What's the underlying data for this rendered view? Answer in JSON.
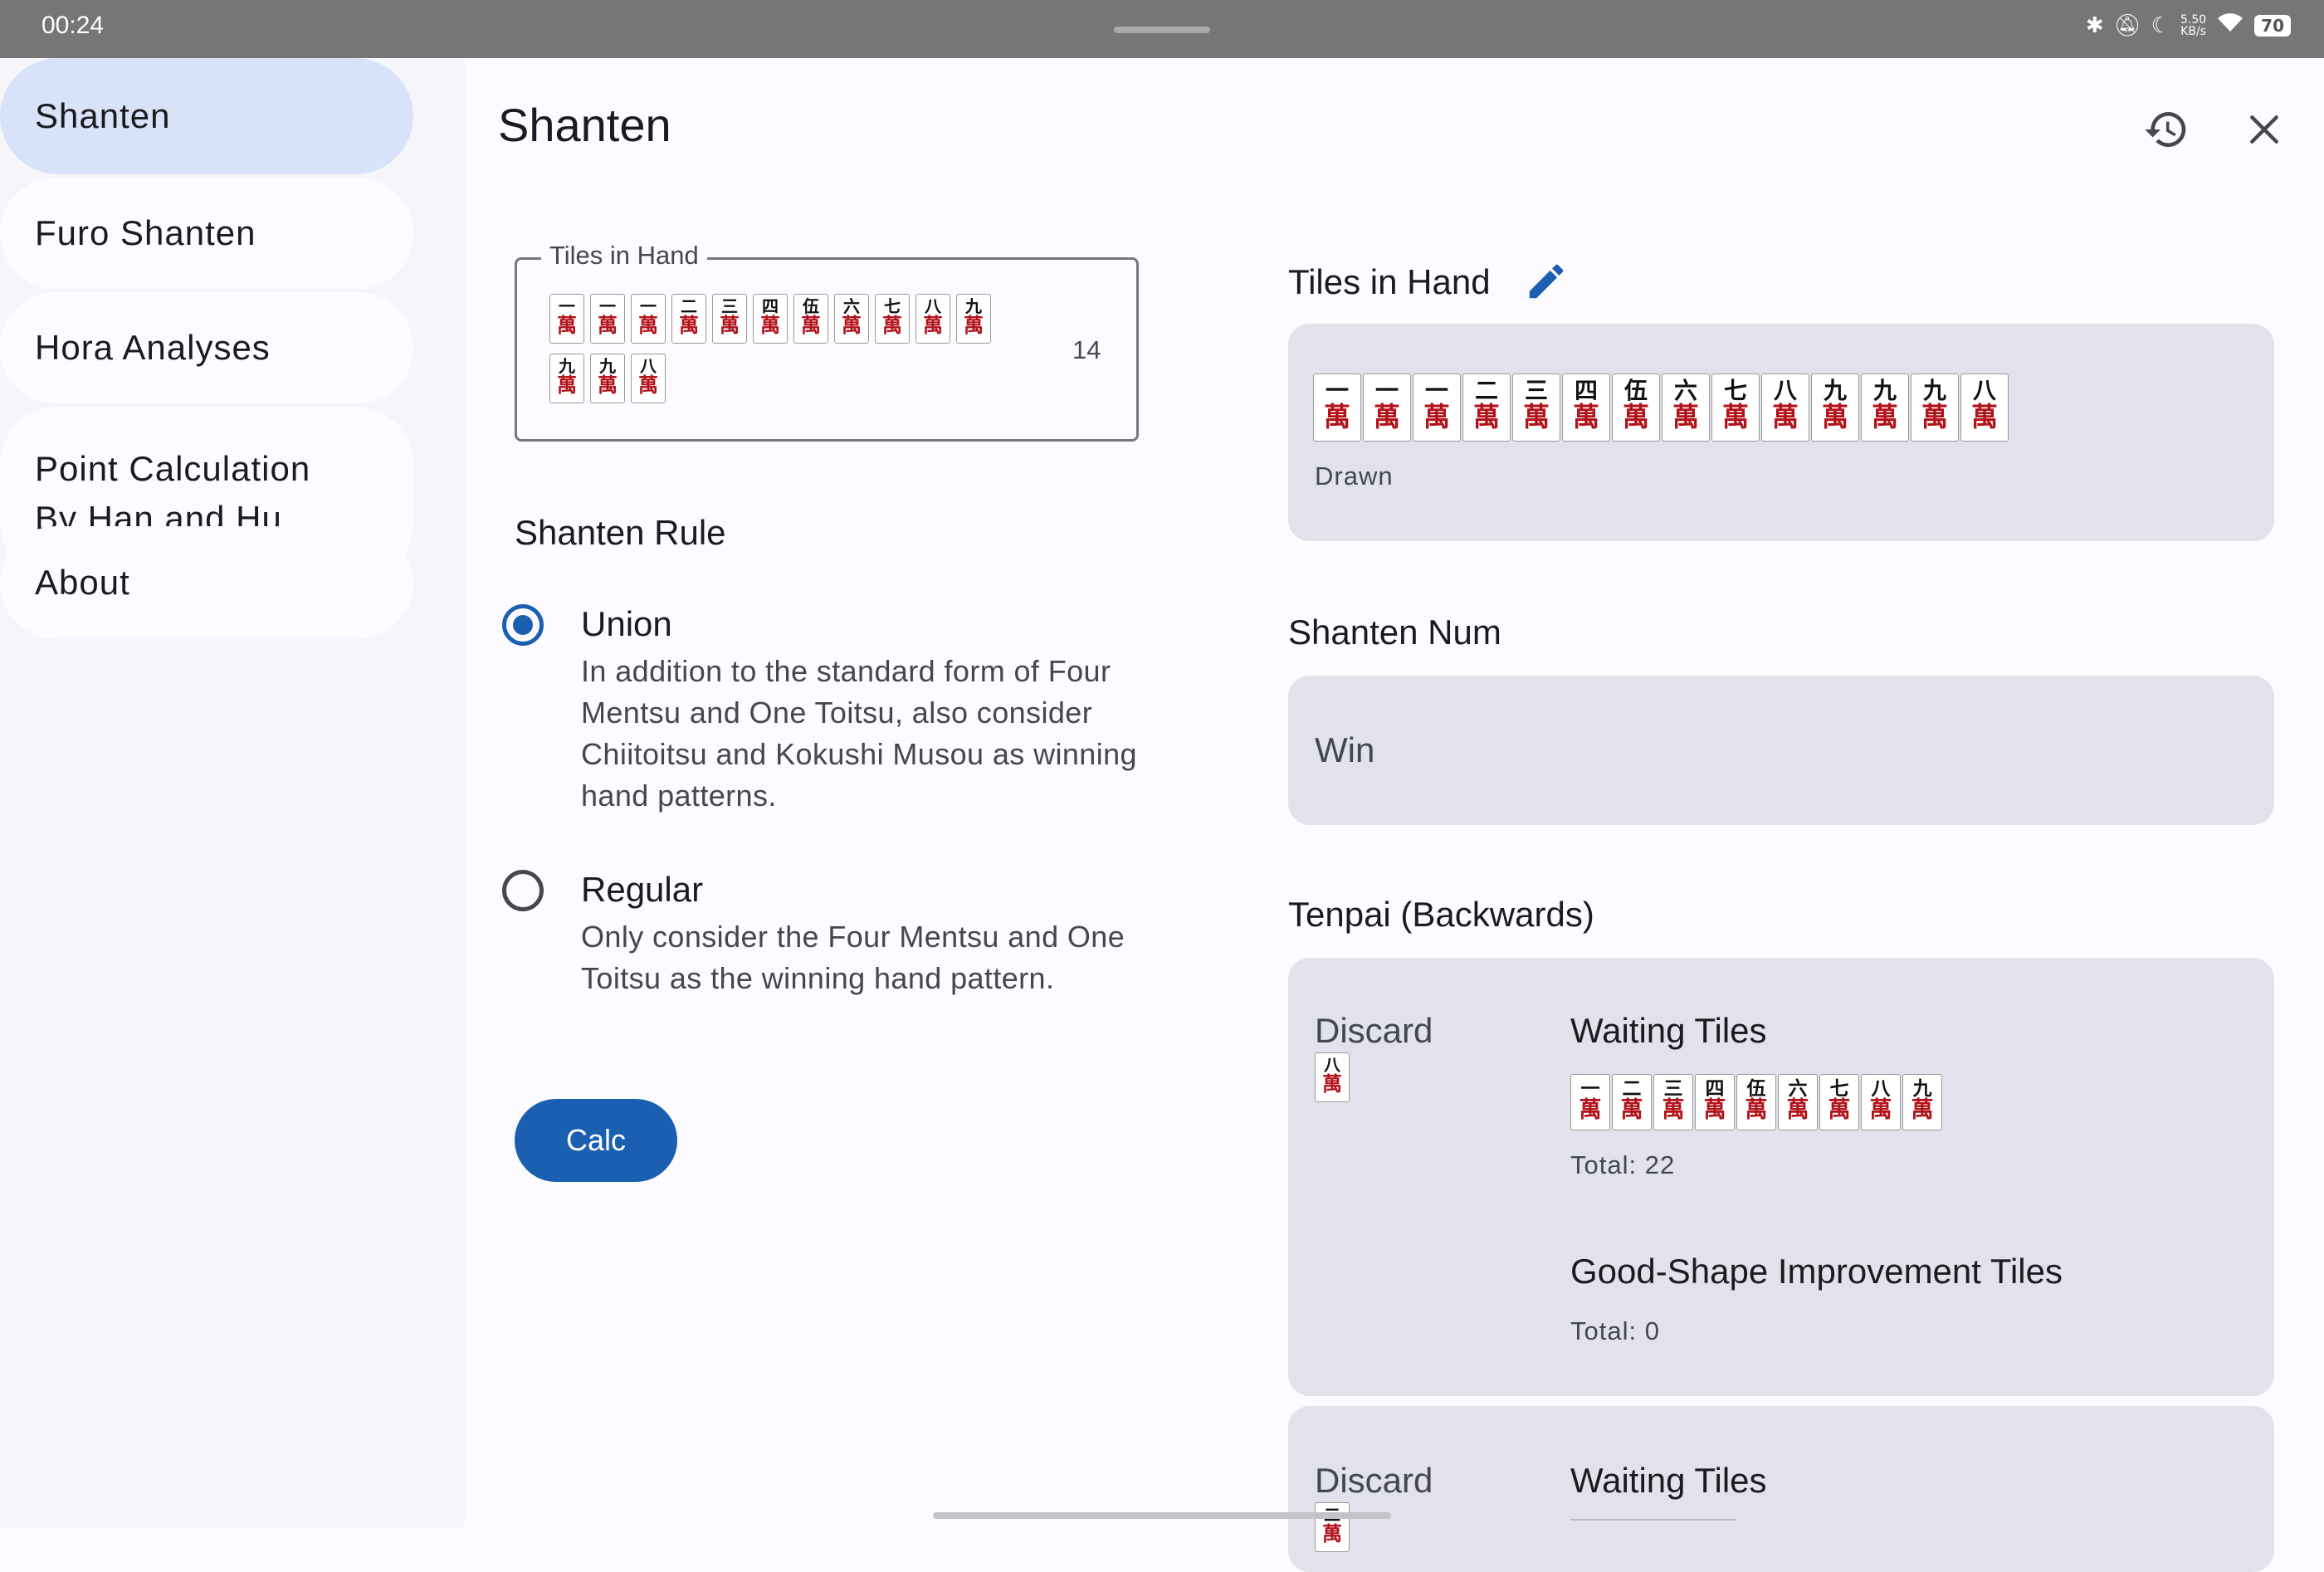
{
  "status": {
    "time": "00:24",
    "speed_top": "5.50",
    "speed_bottom": "KB/s",
    "battery": "70"
  },
  "sidebar": {
    "items": [
      {
        "label": "Shanten",
        "active": true
      },
      {
        "label": "Furo Shanten"
      },
      {
        "label": "Hora Analyses"
      },
      {
        "label": "Point Calculation",
        "label2": "By Han and Hu"
      },
      {
        "label": "About"
      }
    ]
  },
  "header": {
    "title": "Shanten",
    "history_icon": "history-icon",
    "close_icon": "close-icon"
  },
  "input": {
    "label": "Tiles in Hand",
    "count": "14",
    "tiles": [
      "一",
      "一",
      "一",
      "二",
      "三",
      "四",
      "伍",
      "六",
      "七",
      "八",
      "九",
      "九",
      "九",
      "八"
    ],
    "suit_glyph": "萬"
  },
  "rule": {
    "title": "Shanten Rule",
    "options": [
      {
        "label": "Union",
        "selected": true,
        "desc": "In addition to the standard form of Four Mentsu and One Toitsu, also consider Chiitoitsu and Kokushi Musou as winning hand patterns."
      },
      {
        "label": "Regular",
        "selected": false,
        "desc": "Only consider the Four Mentsu and One Toitsu as the winning hand pattern."
      }
    ]
  },
  "calc_label": "Calc",
  "result": {
    "hand_title": "Tiles in Hand",
    "edit_icon": "pencil-icon",
    "hand_tiles": [
      "一",
      "一",
      "一",
      "二",
      "三",
      "四",
      "伍",
      "六",
      "七",
      "八",
      "九",
      "九",
      "九",
      "八"
    ],
    "drawn_label": "Drawn",
    "shanten_title": "Shanten Num",
    "shanten_value": "Win",
    "tenpai_title": "Tenpai (Backwards)",
    "groups": [
      {
        "discard_label": "Discard",
        "discard_tile": "八",
        "waiting_title": "Waiting Tiles",
        "waiting_tiles": [
          "一",
          "二",
          "三",
          "四",
          "伍",
          "六",
          "七",
          "八",
          "九"
        ],
        "waiting_total": "Total: 22",
        "good_title": "Good-Shape Improvement Tiles",
        "good_total": "Total: 0"
      },
      {
        "discard_label": "Discard",
        "discard_tile": "二",
        "waiting_title": "Waiting Tiles"
      }
    ]
  }
}
